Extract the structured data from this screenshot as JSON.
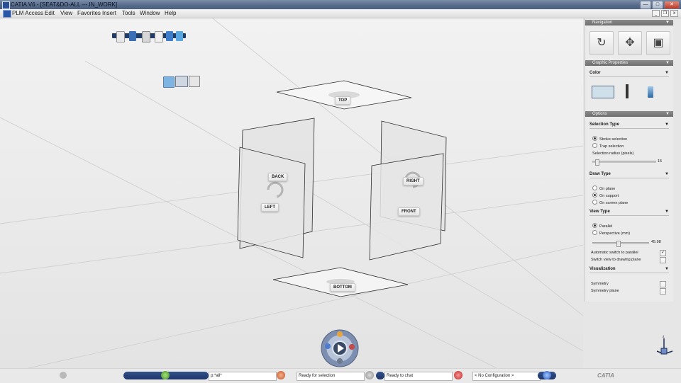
{
  "window": {
    "title": "CATIA V6 - [SEAT&DO-ALL --- IN_WORK]",
    "buttons": {
      "minimize": "—",
      "maximize": "□",
      "close": "✕"
    }
  },
  "menubar": {
    "items": [
      "PLM Access",
      "Edit",
      "View",
      "Favorites",
      "Insert",
      "Tools",
      "Window",
      "Help"
    ],
    "doc_buttons": {
      "minimize": "_",
      "restore": "❐",
      "close": "x"
    }
  },
  "viewport": {
    "planes": {
      "top": "TOP",
      "back": "BACK",
      "left": "LEFT",
      "right": "RIGHT",
      "front": "FRONT",
      "bottom": "BOTTOM"
    }
  },
  "panel": {
    "navigation": {
      "header": "Navigation"
    },
    "graphic_properties": {
      "header": "Graphic Properties",
      "color_section": "Color"
    },
    "options": {
      "header": "Options",
      "selection_type": {
        "title": "Selection Type",
        "stroke": "Stroke selection",
        "trap": "Trap selection",
        "radius_label": "Selection radius (pixels)",
        "radius_value": "15",
        "radius_fraction": 0.05,
        "selected": "stroke"
      },
      "draw_type": {
        "title": "Draw Type",
        "on_plane": "On plane",
        "on_support": "On support",
        "on_screen_plane": "On screen plane",
        "selected": "on_support"
      },
      "view_type": {
        "title": "View Type",
        "parallel": "Parallel",
        "perspective": "Perspective (mm)",
        "perspective_value": "45.98",
        "perspective_fraction": 0.45,
        "selected": "parallel",
        "auto_switch": "Automatic switch to parallel",
        "auto_switch_checked": true,
        "switch_drawing": "Switch view to drawing plane",
        "switch_drawing_checked": false
      },
      "visualization": {
        "title": "Visualization",
        "symmetry": "Symmetry",
        "symmetry_checked": false,
        "symmetry_plane": "Symmetry plane",
        "symmetry_plane_checked": false
      }
    }
  },
  "statusbar": {
    "command_input": "p:*all*",
    "selection_status": "Ready for selection",
    "chat_status": "Ready to chat",
    "configuration": "< No Configuration >",
    "brand": "CATIA"
  },
  "colors": {
    "swatch": "#cfe0ea",
    "accent": "#1f3b66"
  }
}
